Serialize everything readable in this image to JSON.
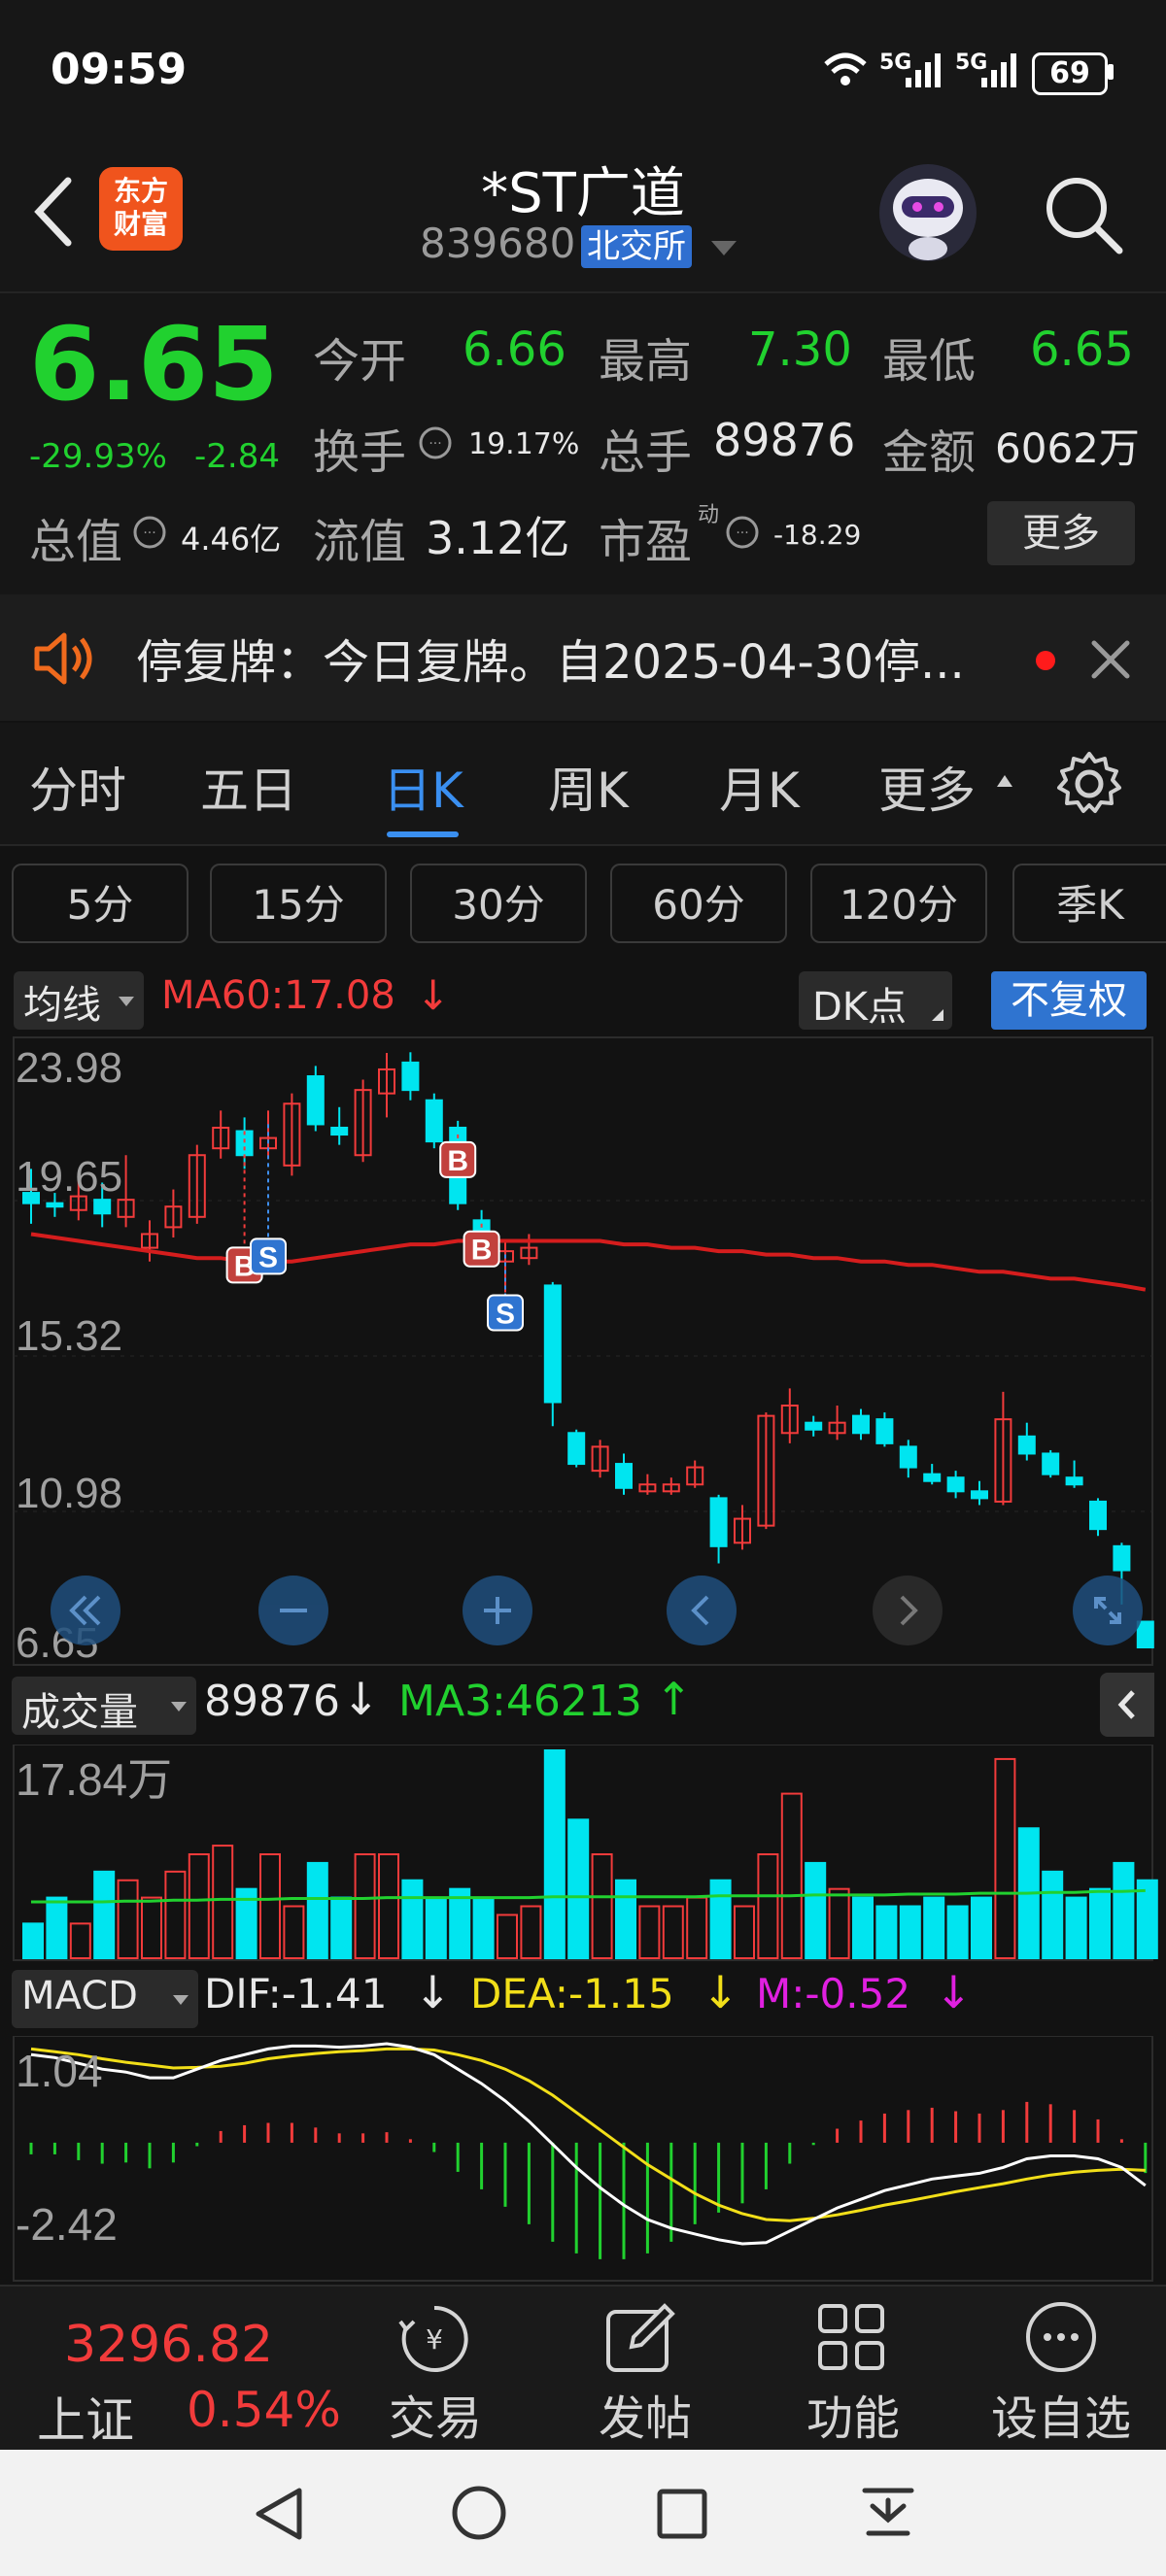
{
  "status": {
    "time": "09:59",
    "net1": "5G",
    "net2": "5G",
    "battery": "69"
  },
  "header": {
    "title": "*ST广道",
    "code": "839680",
    "exchange": "北交所",
    "logo_line1": "东方",
    "logo_line2": "财富"
  },
  "quote": {
    "price": "6.65",
    "pct": "-29.93%",
    "change": "-2.84",
    "open_label": "今开",
    "open": "6.66",
    "high_label": "最高",
    "high": "7.30",
    "low_label": "最低",
    "low": "6.65",
    "turnover_label": "换手",
    "turnover": "19.17%",
    "vol_label": "总手",
    "vol": "89876",
    "amount_label": "金额",
    "amount": "6062万",
    "mktcap_label": "总值",
    "mktcap": "4.46亿",
    "float_label": "流值",
    "float": "3.12亿",
    "pe_label": "市盈",
    "pe_sup": "动",
    "pe": "-18.29",
    "more": "更多"
  },
  "notice": {
    "text": "停复牌：今日复牌。自2025-04-30停..."
  },
  "tabs": [
    "分时",
    "五日",
    "日K",
    "周K",
    "月K",
    "更多"
  ],
  "period_tabs": [
    "5分",
    "15分",
    "30分",
    "60分",
    "120分",
    "季K"
  ],
  "kline": {
    "ma_dropdown": "均线",
    "ma60": "MA60:17.08",
    "ma60_arrow": "↓",
    "dk": "DK点",
    "fq": "不复权",
    "y_labels": [
      "23.98",
      "19.65",
      "15.32",
      "10.98",
      "6.65"
    ],
    "markers": [
      "B",
      "S",
      "B",
      "B",
      "S"
    ]
  },
  "volume": {
    "dropdown": "成交量",
    "value": "89876",
    "value_arrow": "↓",
    "ma3": "MA3:46213",
    "ma3_arrow": "↑",
    "y_label": "17.84万"
  },
  "macd": {
    "dropdown": "MACD",
    "dif": "DIF:-1.41",
    "dif_arrow": "↓",
    "dea": "DEA:-1.15",
    "dea_arrow": "↓",
    "m": "M:-0.52",
    "m_arrow": "↓",
    "y_top": "1.04",
    "y_bottom": "-2.42"
  },
  "bottom": {
    "index_value": "3296.82",
    "index_name": "上证",
    "index_pct": "0.54%",
    "nav": [
      "交易",
      "发帖",
      "功能",
      "设自选"
    ]
  },
  "colors": {
    "up": "#f23b3b",
    "down": "#00e5f0",
    "ma60": "#d51d1d",
    "dif": "#ffffff",
    "dea": "#f2df19",
    "m": "#e020e0",
    "accent": "#2f7de1"
  },
  "chart_data": {
    "type": "candlestick",
    "y_range": [
      6.65,
      23.98
    ],
    "candles": [
      {
        "o": 19.9,
        "c": 19.6,
        "h": 20.6,
        "l": 19.0
      },
      {
        "o": 19.6,
        "c": 19.5,
        "h": 19.9,
        "l": 19.2
      },
      {
        "o": 19.4,
        "c": 19.8,
        "h": 20.3,
        "l": 19.1
      },
      {
        "o": 19.7,
        "c": 19.3,
        "h": 20.2,
        "l": 18.9
      },
      {
        "o": 19.2,
        "c": 19.7,
        "h": 21.0,
        "l": 18.9
      },
      {
        "o": 18.3,
        "c": 18.7,
        "h": 19.1,
        "l": 17.9
      },
      {
        "o": 18.9,
        "c": 19.5,
        "h": 20.0,
        "l": 18.6
      },
      {
        "o": 19.2,
        "c": 21.0,
        "h": 21.3,
        "l": 19.0
      },
      {
        "o": 21.2,
        "c": 21.8,
        "h": 22.3,
        "l": 20.9
      },
      {
        "o": 21.7,
        "c": 21.0,
        "h": 22.1,
        "l": 20.6
      },
      {
        "o": 21.2,
        "c": 21.5,
        "h": 22.3,
        "l": 20.9
      },
      {
        "o": 20.7,
        "c": 22.5,
        "h": 22.8,
        "l": 20.4
      },
      {
        "o": 23.3,
        "c": 21.9,
        "h": 23.6,
        "l": 21.7
      },
      {
        "o": 21.8,
        "c": 21.6,
        "h": 22.4,
        "l": 21.3
      },
      {
        "o": 21.0,
        "c": 22.9,
        "h": 23.2,
        "l": 20.8
      },
      {
        "o": 22.8,
        "c": 23.5,
        "h": 23.98,
        "l": 22.1
      },
      {
        "o": 23.7,
        "c": 22.9,
        "h": 24.0,
        "l": 22.6
      },
      {
        "o": 22.6,
        "c": 21.4,
        "h": 22.8,
        "l": 21.2
      },
      {
        "o": 21.8,
        "c": 19.6,
        "h": 22.0,
        "l": 19.4
      },
      {
        "o": 19.1,
        "c": 18.3,
        "h": 19.4,
        "l": 18.1
      },
      {
        "o": 17.9,
        "c": 18.2,
        "h": 18.5,
        "l": 17.0
      },
      {
        "o": 18.0,
        "c": 18.3,
        "h": 18.7,
        "l": 17.8
      },
      {
        "o": 17.2,
        "c": 13.8,
        "h": 17.3,
        "l": 13.1
      },
      {
        "o": 12.9,
        "c": 12.0,
        "h": 13.0,
        "l": 11.9
      },
      {
        "o": 11.8,
        "c": 12.5,
        "h": 12.7,
        "l": 11.6
      },
      {
        "o": 12.0,
        "c": 11.3,
        "h": 12.3,
        "l": 11.1
      },
      {
        "o": 11.2,
        "c": 11.4,
        "h": 11.7,
        "l": 11.1
      },
      {
        "o": 11.2,
        "c": 11.4,
        "h": 11.6,
        "l": 11.1
      },
      {
        "o": 11.4,
        "c": 11.9,
        "h": 12.1,
        "l": 11.3
      },
      {
        "o": 11.0,
        "c": 9.6,
        "h": 11.1,
        "l": 9.1
      },
      {
        "o": 9.7,
        "c": 10.4,
        "h": 10.8,
        "l": 9.5
      },
      {
        "o": 10.2,
        "c": 13.4,
        "h": 13.5,
        "l": 10.1
      },
      {
        "o": 12.9,
        "c": 13.7,
        "h": 14.2,
        "l": 12.6
      },
      {
        "o": 13.2,
        "c": 13.0,
        "h": 13.4,
        "l": 12.8
      },
      {
        "o": 12.9,
        "c": 13.2,
        "h": 13.7,
        "l": 12.7
      },
      {
        "o": 13.4,
        "c": 12.9,
        "h": 13.6,
        "l": 12.7
      },
      {
        "o": 13.3,
        "c": 12.6,
        "h": 13.5,
        "l": 12.5
      },
      {
        "o": 12.5,
        "c": 11.9,
        "h": 12.7,
        "l": 11.6
      },
      {
        "o": 11.7,
        "c": 11.5,
        "h": 12.0,
        "l": 11.4
      },
      {
        "o": 11.6,
        "c": 11.2,
        "h": 11.8,
        "l": 11.0
      },
      {
        "o": 11.2,
        "c": 11.0,
        "h": 11.5,
        "l": 10.8
      },
      {
        "o": 10.9,
        "c": 13.3,
        "h": 14.1,
        "l": 10.8
      },
      {
        "o": 12.8,
        "c": 12.3,
        "h": 13.2,
        "l": 12.1
      },
      {
        "o": 12.3,
        "c": 11.7,
        "h": 12.4,
        "l": 11.6
      },
      {
        "o": 11.6,
        "c": 11.4,
        "h": 12.1,
        "l": 11.3
      },
      {
        "o": 10.9,
        "c": 10.1,
        "h": 11.0,
        "l": 9.9
      },
      {
        "o": 9.6,
        "c": 8.9,
        "h": 9.7,
        "l": 7.9
      },
      {
        "o": 7.4,
        "c": 6.65,
        "h": 7.3,
        "l": 6.65
      }
    ],
    "ma60": [
      18.7,
      18.6,
      18.5,
      18.4,
      18.3,
      18.2,
      18.1,
      18.0,
      18.0,
      17.9,
      17.9,
      17.9,
      18.0,
      18.1,
      18.2,
      18.3,
      18.4,
      18.4,
      18.5,
      18.5,
      18.5,
      18.5,
      18.5,
      18.5,
      18.5,
      18.4,
      18.4,
      18.3,
      18.3,
      18.2,
      18.2,
      18.1,
      18.1,
      18.0,
      18.0,
      17.9,
      17.9,
      17.8,
      17.8,
      17.7,
      17.6,
      17.6,
      17.5,
      17.4,
      17.4,
      17.3,
      17.2,
      17.08
    ],
    "volume_ylabel": "17.84万",
    "volume": [
      4,
      7,
      4,
      10,
      9,
      7,
      10,
      12,
      13,
      8,
      12,
      6,
      11,
      7,
      12,
      12,
      9,
      7,
      8,
      7,
      5,
      6,
      24,
      16,
      12,
      9,
      6,
      6,
      7,
      9,
      6,
      12,
      19,
      11,
      8,
      7,
      6,
      6,
      7,
      6,
      7,
      23,
      15,
      10,
      7,
      8,
      11,
      9
    ],
    "vol_ma3": [
      6.5,
      6.5,
      6.5,
      6.5,
      6.6,
      6.6,
      6.7,
      6.7,
      6.8,
      6.8,
      6.8,
      6.9,
      6.9,
      6.9,
      6.9,
      7.0,
      7.0,
      7.0,
      7.0,
      7.0,
      7.0,
      7.0,
      7.1,
      7.1,
      7.1,
      7.1,
      7.1,
      7.1,
      7.1,
      7.2,
      7.2,
      7.2,
      7.2,
      7.3,
      7.3,
      7.3,
      7.3,
      7.4,
      7.4,
      7.4,
      7.5,
      7.5,
      7.5,
      7.6,
      7.6,
      7.7,
      7.7,
      7.8
    ],
    "macd_range": [
      -2.42,
      1.04
    ],
    "dif": [
      0.85,
      0.8,
      0.7,
      0.6,
      0.55,
      0.45,
      0.45,
      0.6,
      0.75,
      0.85,
      0.95,
      1.0,
      1.0,
      0.98,
      1.0,
      1.04,
      0.98,
      0.85,
      0.6,
      0.35,
      0.05,
      -0.3,
      -0.7,
      -1.1,
      -1.45,
      -1.75,
      -2.0,
      -2.15,
      -2.25,
      -2.35,
      -2.42,
      -2.4,
      -2.2,
      -2.0,
      -1.8,
      -1.65,
      -1.5,
      -1.4,
      -1.3,
      -1.25,
      -1.2,
      -1.1,
      -0.95,
      -0.9,
      -0.9,
      -0.95,
      -1.1,
      -1.41
    ],
    "dea": [
      0.95,
      0.9,
      0.85,
      0.78,
      0.72,
      0.67,
      0.62,
      0.63,
      0.65,
      0.7,
      0.78,
      0.83,
      0.87,
      0.9,
      0.92,
      0.95,
      0.95,
      0.93,
      0.85,
      0.75,
      0.6,
      0.4,
      0.15,
      -0.15,
      -0.45,
      -0.75,
      -1.05,
      -1.3,
      -1.55,
      -1.75,
      -1.9,
      -2.0,
      -2.02,
      -1.98,
      -1.92,
      -1.84,
      -1.75,
      -1.68,
      -1.6,
      -1.52,
      -1.45,
      -1.38,
      -1.3,
      -1.23,
      -1.18,
      -1.15,
      -1.13,
      -1.15
    ],
    "macd_bar": [
      -0.2,
      -0.2,
      -0.3,
      -0.36,
      -0.34,
      -0.44,
      -0.34,
      -0.06,
      0.2,
      0.3,
      0.34,
      0.34,
      0.26,
      0.16,
      0.16,
      0.18,
      0.06,
      -0.16,
      -0.5,
      -0.8,
      -1.1,
      -1.4,
      -1.7,
      -1.9,
      -2.0,
      -2.0,
      -1.9,
      -1.7,
      -1.4,
      -1.2,
      -1.04,
      -0.8,
      -0.36,
      -0.04,
      0.24,
      0.38,
      0.5,
      0.56,
      0.6,
      0.54,
      0.5,
      0.56,
      0.7,
      0.66,
      0.56,
      0.4,
      0.06,
      -0.52
    ]
  }
}
